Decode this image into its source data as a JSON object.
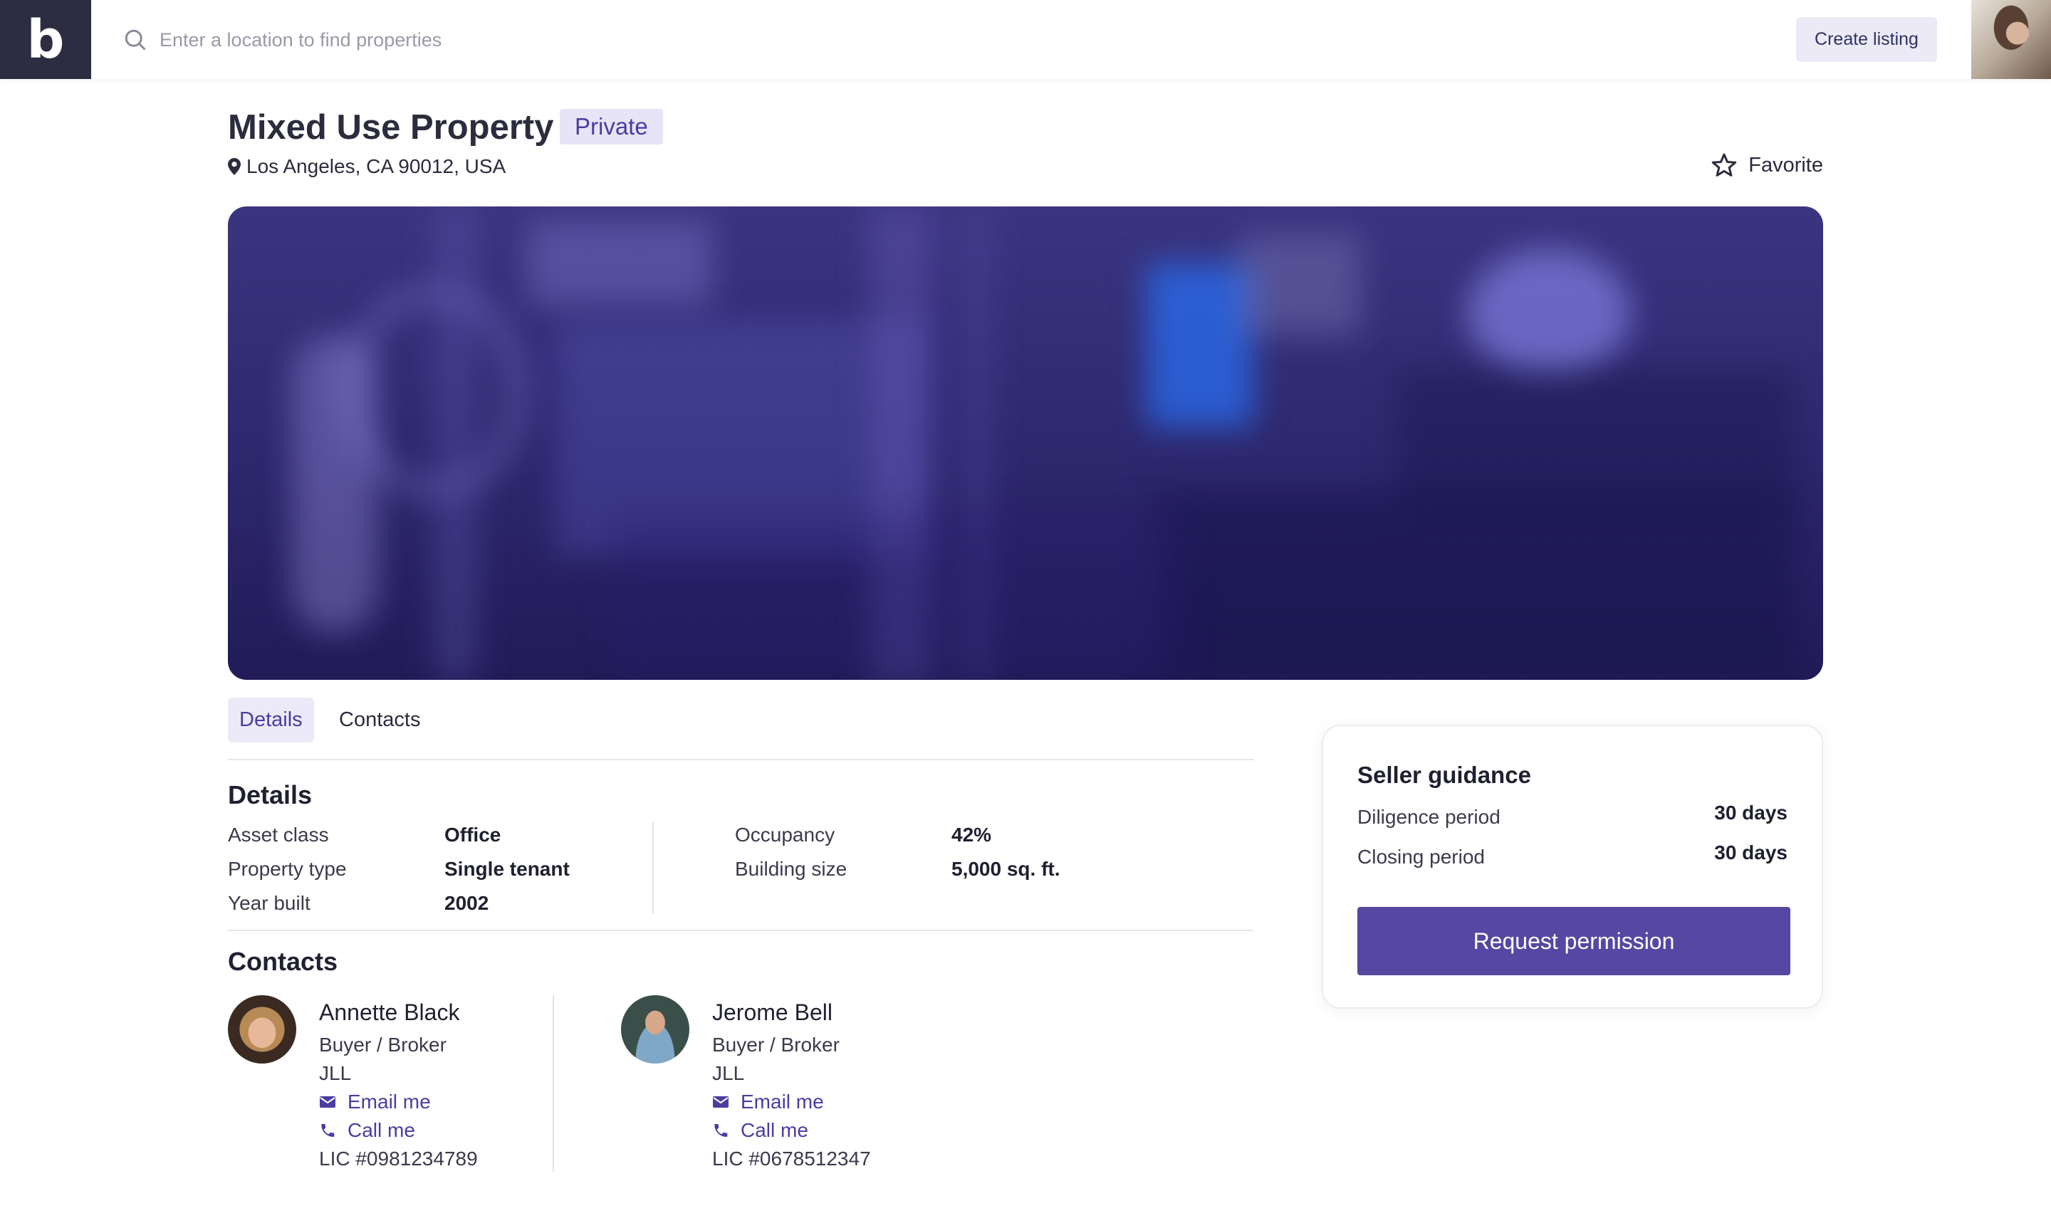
{
  "header": {
    "logo_letter": "b",
    "search": {
      "placeholder": "Enter a location to find properties"
    },
    "create_listing_label": "Create listing"
  },
  "property": {
    "title": "Mixed Use Property",
    "badge": "Private",
    "location": "Los Angeles, CA 90012, USA",
    "favorite_label": "Favorite"
  },
  "tabs": [
    {
      "label": "Details",
      "active": true
    },
    {
      "label": "Contacts",
      "active": false
    }
  ],
  "details": {
    "heading": "Details",
    "items": [
      {
        "label": "Asset class",
        "value": "Office"
      },
      {
        "label": "Property type",
        "value": "Single tenant"
      },
      {
        "label": "Year built",
        "value": "2002"
      },
      {
        "label": "Occupancy",
        "value": "42%"
      },
      {
        "label": "Building size",
        "value": "5,000 sq. ft."
      }
    ]
  },
  "contacts": {
    "heading": "Contacts",
    "people": [
      {
        "name": "Annette Black",
        "role": "Buyer / Broker",
        "company": "JLL",
        "email_label": "Email me",
        "call_label": "Call me",
        "license": "LIC #0981234789"
      },
      {
        "name": "Jerome Bell",
        "role": "Buyer / Broker",
        "company": "JLL",
        "email_label": "Email me",
        "call_label": "Call me",
        "license": "LIC #0678512347"
      }
    ]
  },
  "seller_guidance": {
    "title": "Seller guidance",
    "rows": [
      {
        "label": "Diligence period",
        "value": "30 days"
      },
      {
        "label": "Closing period",
        "value": "30 days"
      }
    ],
    "button_label": "Request permission"
  },
  "colors": {
    "accent": "#5647a3",
    "badge_bg": "#e7e4f7",
    "logo_bg": "#2c2d40"
  },
  "icons": [
    "search-icon",
    "map-pin-icon",
    "star-icon",
    "envelope-icon",
    "phone-icon"
  ]
}
